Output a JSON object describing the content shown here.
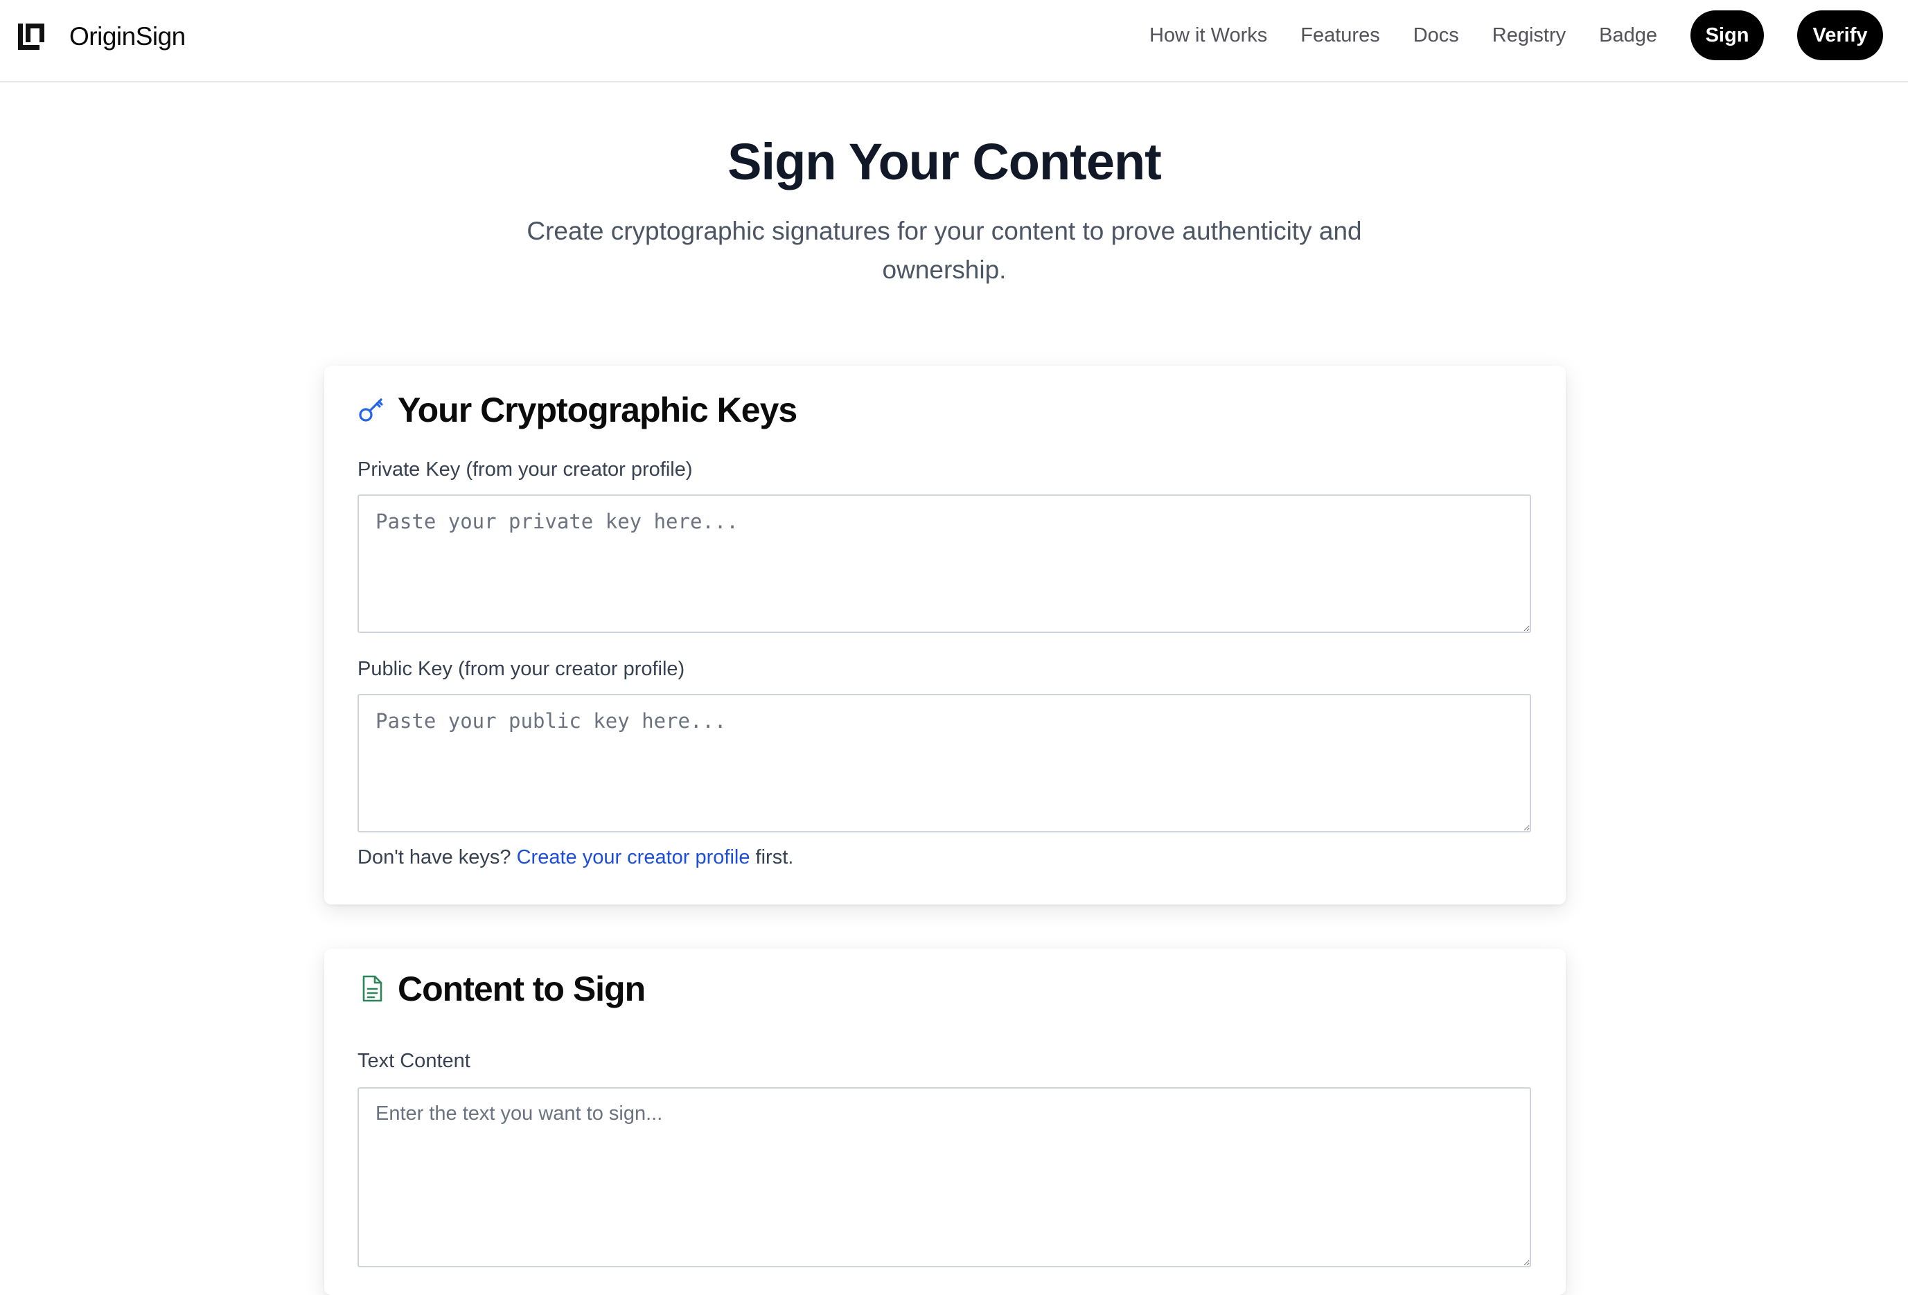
{
  "navbar": {
    "brand": "OriginSign",
    "links": [
      "How it Works",
      "Features",
      "Docs",
      "Registry",
      "Badge"
    ],
    "sign_button": "Sign",
    "verify_button": "Verify"
  },
  "hero": {
    "title": "Sign Your Content",
    "subtitle": "Create cryptographic signatures for your content to prove authenticity and ownership."
  },
  "keys_card": {
    "icon": "key-icon",
    "heading": "Your Cryptographic Keys",
    "private_key": {
      "label": "Private Key (from your creator profile)",
      "placeholder": "Paste your private key here...",
      "value": ""
    },
    "public_key": {
      "label": "Public Key (from your creator profile)",
      "placeholder": "Paste your public key here...",
      "value": ""
    },
    "help": {
      "prefix": "Don't have keys? ",
      "link": "Create your creator profile",
      "suffix": " first."
    }
  },
  "content_card": {
    "icon": "document-icon",
    "heading": "Content to Sign",
    "text_content": {
      "label": "Text Content",
      "placeholder": "Enter the text you want to sign...",
      "value": ""
    }
  },
  "colors": {
    "accent_link": "#1d4ed8",
    "key_icon": "#2563eb",
    "document_icon": "#2f855a",
    "button_bg": "#000000"
  }
}
